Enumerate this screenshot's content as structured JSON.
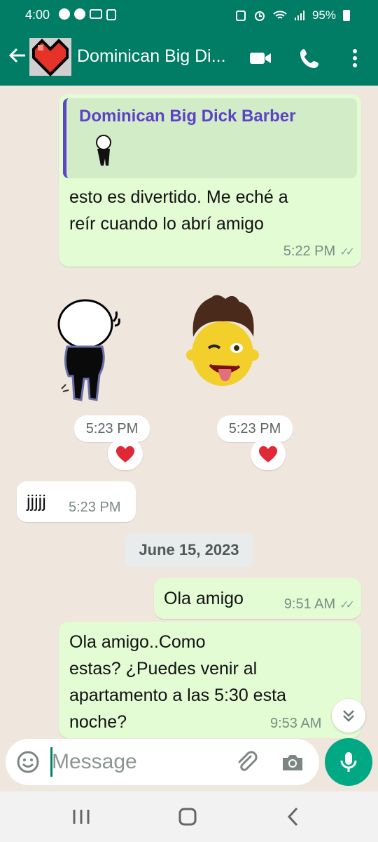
{
  "status_bar": {
    "time": "4:00",
    "battery": "95%"
  },
  "header": {
    "contact_name": "Dominican Big Di...",
    "icons": [
      "back-arrow-icon",
      "avatar",
      "video-call-icon",
      "voice-call-icon",
      "more-options-icon"
    ]
  },
  "messages": [
    {
      "type": "outgoing-reply",
      "quoted_name": "Dominican Big Dick Barber",
      "quoted_content": "sticker",
      "text_line1": "esto es divertido.  Me eché a",
      "text_line2": "reír cuando lo abrí amigo",
      "time": "5:22 PM"
    },
    {
      "type": "incoming-sticker",
      "sticker": "stick-figure-sticker",
      "time": "5:23 PM",
      "reaction": "❤️"
    },
    {
      "type": "incoming-sticker",
      "sticker": "memoji-wink-sticker",
      "time": "5:23 PM",
      "reaction": "❤️"
    },
    {
      "type": "incoming",
      "text": "jjjjj",
      "time": "5:23 PM"
    }
  ],
  "date_separator": "June 15, 2023",
  "messages_after": [
    {
      "type": "outgoing",
      "text": "Ola amigo",
      "time": "9:51 AM"
    },
    {
      "type": "outgoing",
      "line1": "Ola amigo..Como",
      "line2": "estas?  ¿Puedes venir al",
      "line3": "apartamento a las 5:30 esta",
      "line4": "noche?",
      "time": "9:53 AM"
    }
  ],
  "composer": {
    "placeholder": "Message"
  },
  "colors": {
    "brand": "#007d64",
    "outgoing_bubble": "#e3fcd4",
    "chat_bg": "#efe7dd",
    "accent": "#00a884"
  }
}
